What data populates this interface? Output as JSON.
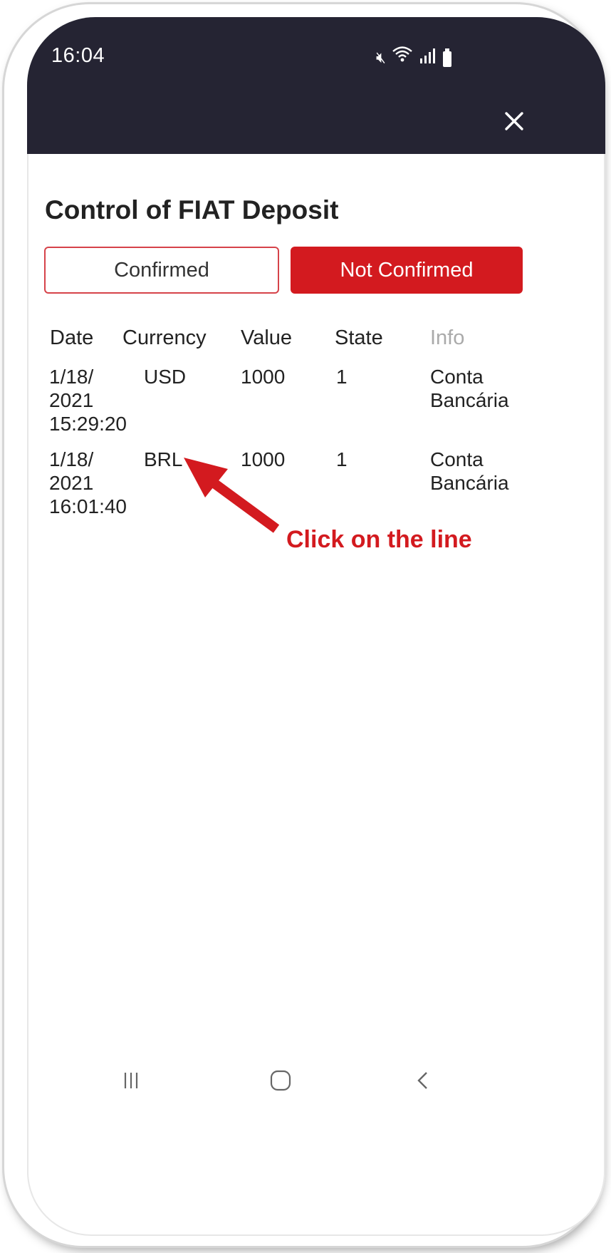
{
  "status_bar": {
    "time": "16:04",
    "icons": [
      "mute-icon",
      "wifi-icon",
      "signal-icon",
      "battery-icon"
    ]
  },
  "header": {
    "close_icon": "close-icon"
  },
  "page": {
    "title": "Control of FIAT Deposit"
  },
  "tabs": [
    {
      "label": "Confirmed",
      "active": false
    },
    {
      "label": "Not Confirmed",
      "active": true
    }
  ],
  "table": {
    "columns": [
      "Date",
      "Currency",
      "Value",
      "State",
      "Info"
    ],
    "rows": [
      {
        "date": "1/18/\n2021\n15:29:20",
        "currency": "USD",
        "value": "1000",
        "state": "1",
        "info": "Conta\nBancária"
      },
      {
        "date": "1/18/\n2021\n16:01:40",
        "currency": "BRL",
        "value": "1000",
        "state": "1",
        "info": "Conta\nBancária"
      }
    ]
  },
  "annotation": {
    "text": "Click on the line",
    "color": "#d31a1f"
  },
  "nav_bar": {
    "icons": [
      "recent-apps-icon",
      "home-icon",
      "back-icon"
    ]
  },
  "colors": {
    "header_bg": "#252433",
    "accent_red": "#d31a1f"
  }
}
